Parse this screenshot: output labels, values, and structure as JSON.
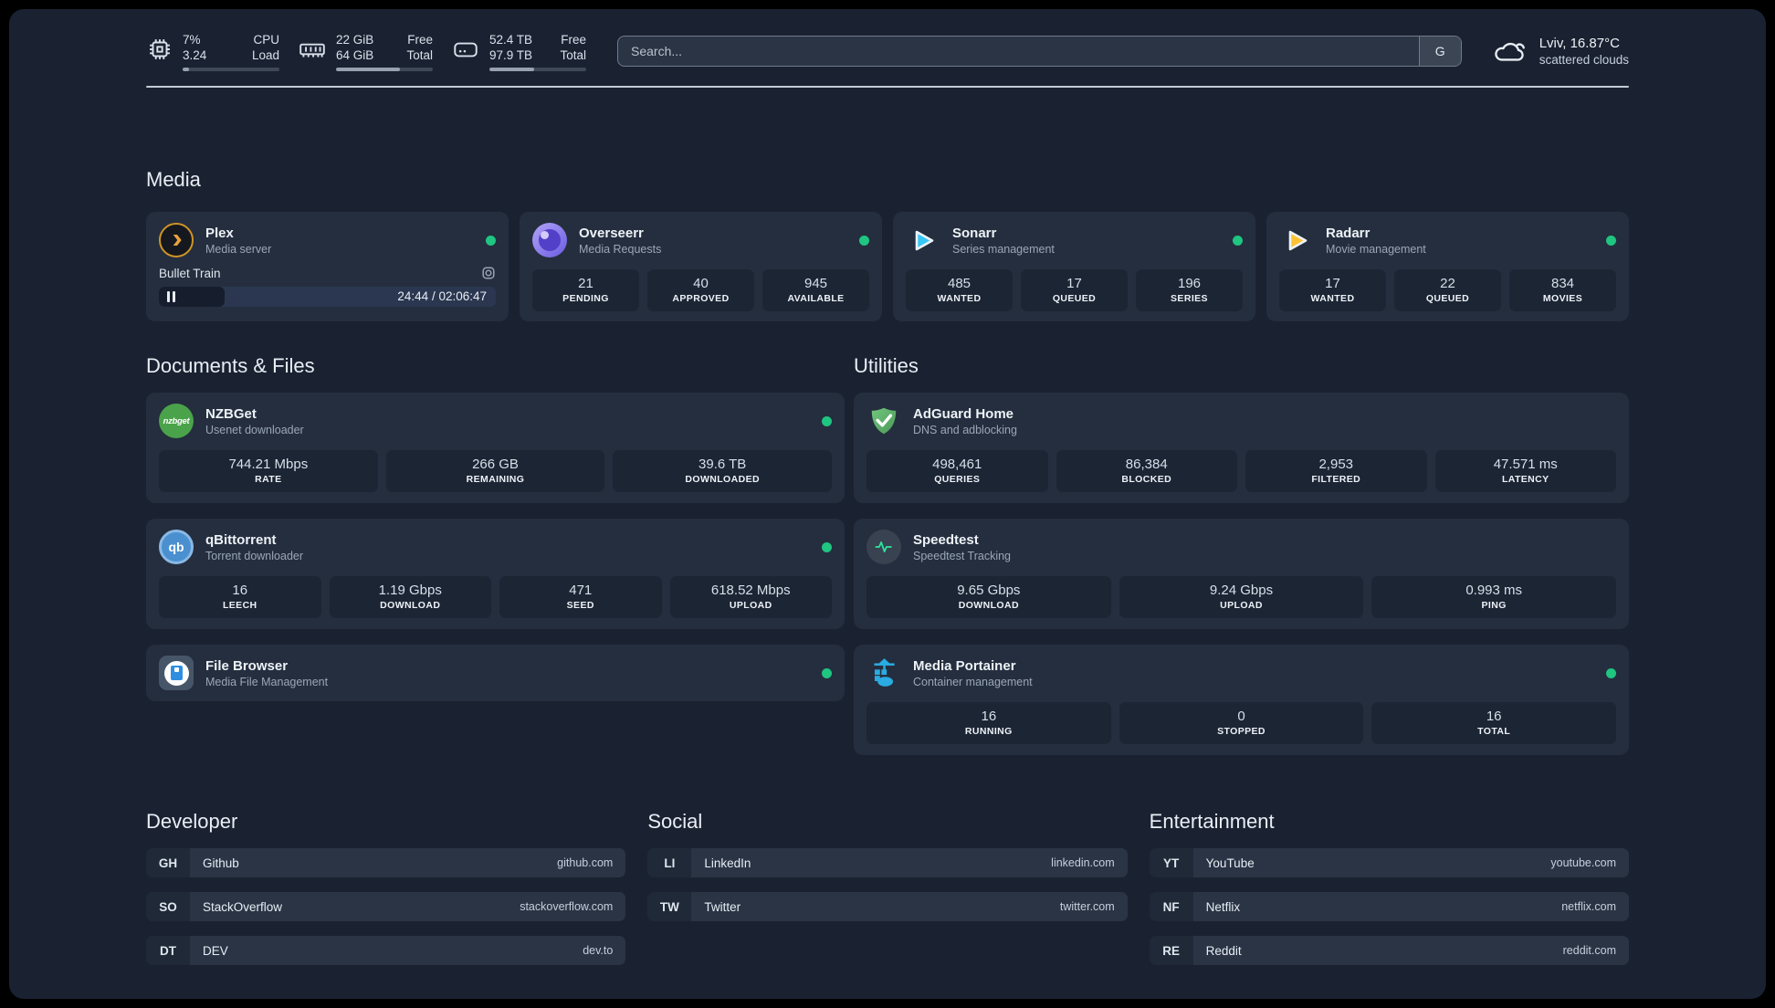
{
  "colors": {
    "status_online": "#1fc580",
    "background": "#1a2231",
    "card": "#242e3e"
  },
  "header": {
    "resources": [
      {
        "icon": "cpu-icon",
        "value_top": "7%",
        "value_bottom": "3.24",
        "label_top": "CPU",
        "label_bottom": "Load",
        "progress": 7
      },
      {
        "icon": "memory-icon",
        "value_top": "22 GiB",
        "value_bottom": "64 GiB",
        "label_top": "Free",
        "label_bottom": "Total",
        "progress": 66
      },
      {
        "icon": "disk-icon",
        "value_top": "52.4 TB",
        "value_bottom": "97.9 TB",
        "label_top": "Free",
        "label_bottom": "Total",
        "progress": 46
      }
    ],
    "search": {
      "placeholder": "Search...",
      "provider_button": "G"
    },
    "weather": {
      "icon": "cloud-icon",
      "location": "Lviv, 16.87°C",
      "condition": "scattered clouds"
    }
  },
  "media": {
    "title": "Media",
    "plex": {
      "name": "Plex",
      "subtitle": "Media server",
      "now_playing": "Bullet Train",
      "time": "24:44 / 02:06:47",
      "progress": 19.5
    },
    "overseerr": {
      "name": "Overseerr",
      "subtitle": "Media Requests",
      "stats": [
        {
          "value": "21",
          "label": "PENDING"
        },
        {
          "value": "40",
          "label": "APPROVED"
        },
        {
          "value": "945",
          "label": "AVAILABLE"
        }
      ]
    },
    "sonarr": {
      "name": "Sonarr",
      "subtitle": "Series management",
      "stats": [
        {
          "value": "485",
          "label": "WANTED"
        },
        {
          "value": "17",
          "label": "QUEUED"
        },
        {
          "value": "196",
          "label": "SERIES"
        }
      ]
    },
    "radarr": {
      "name": "Radarr",
      "subtitle": "Movie management",
      "stats": [
        {
          "value": "17",
          "label": "WANTED"
        },
        {
          "value": "22",
          "label": "QUEUED"
        },
        {
          "value": "834",
          "label": "MOVIES"
        }
      ]
    }
  },
  "documents": {
    "title": "Documents & Files",
    "nzbget": {
      "name": "NZBGet",
      "subtitle": "Usenet downloader",
      "icon_text": "nzbget",
      "stats": [
        {
          "value": "744.21 Mbps",
          "label": "RATE"
        },
        {
          "value": "266 GB",
          "label": "REMAINING"
        },
        {
          "value": "39.6 TB",
          "label": "DOWNLOADED"
        }
      ]
    },
    "qbittorrent": {
      "name": "qBittorrent",
      "subtitle": "Torrent downloader",
      "icon_text": "qb",
      "stats": [
        {
          "value": "16",
          "label": "LEECH"
        },
        {
          "value": "1.19 Gbps",
          "label": "DOWNLOAD"
        },
        {
          "value": "471",
          "label": "SEED"
        },
        {
          "value": "618.52 Mbps",
          "label": "UPLOAD"
        }
      ]
    },
    "filebrowser": {
      "name": "File Browser",
      "subtitle": "Media File Management"
    }
  },
  "utilities": {
    "title": "Utilities",
    "adguard": {
      "name": "AdGuard Home",
      "subtitle": "DNS and adblocking",
      "stats": [
        {
          "value": "498,461",
          "label": "QUERIES"
        },
        {
          "value": "86,384",
          "label": "BLOCKED"
        },
        {
          "value": "2,953",
          "label": "FILTERED"
        },
        {
          "value": "47.571 ms",
          "label": "LATENCY"
        }
      ]
    },
    "speedtest": {
      "name": "Speedtest",
      "subtitle": "Speedtest Tracking",
      "stats": [
        {
          "value": "9.65 Gbps",
          "label": "DOWNLOAD"
        },
        {
          "value": "9.24 Gbps",
          "label": "UPLOAD"
        },
        {
          "value": "0.993 ms",
          "label": "PING"
        }
      ]
    },
    "portainer": {
      "name": "Media Portainer",
      "subtitle": "Container management",
      "stats": [
        {
          "value": "16",
          "label": "RUNNING"
        },
        {
          "value": "0",
          "label": "STOPPED"
        },
        {
          "value": "16",
          "label": "TOTAL"
        }
      ]
    }
  },
  "bookmarks": [
    {
      "title": "Developer",
      "links": [
        {
          "abbr": "GH",
          "name": "Github",
          "url": "github.com"
        },
        {
          "abbr": "SO",
          "name": "StackOverflow",
          "url": "stackoverflow.com"
        },
        {
          "abbr": "DT",
          "name": "DEV",
          "url": "dev.to"
        }
      ]
    },
    {
      "title": "Social",
      "links": [
        {
          "abbr": "LI",
          "name": "LinkedIn",
          "url": "linkedin.com"
        },
        {
          "abbr": "TW",
          "name": "Twitter",
          "url": "twitter.com"
        }
      ]
    },
    {
      "title": "Entertainment",
      "links": [
        {
          "abbr": "YT",
          "name": "YouTube",
          "url": "youtube.com"
        },
        {
          "abbr": "NF",
          "name": "Netflix",
          "url": "netflix.com"
        },
        {
          "abbr": "RE",
          "name": "Reddit",
          "url": "reddit.com"
        }
      ]
    }
  ]
}
